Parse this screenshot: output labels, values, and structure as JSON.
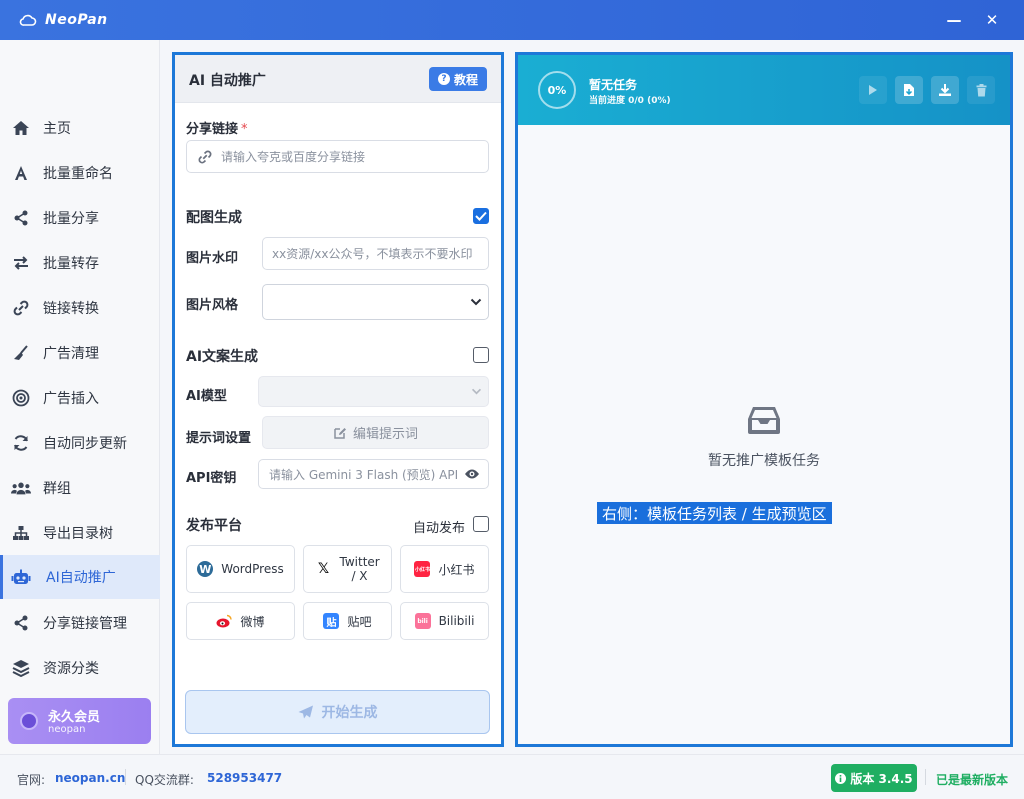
{
  "app": {
    "title": "NeoPan"
  },
  "window": {
    "minimize": "—",
    "close": "✕"
  },
  "sidebar": {
    "items": [
      {
        "label": "主页",
        "icon": "home-icon"
      },
      {
        "label": "批量重命名",
        "icon": "font-icon"
      },
      {
        "label": "批量分享",
        "icon": "share-icon"
      },
      {
        "label": "批量转存",
        "icon": "transfer-icon"
      },
      {
        "label": "链接转换",
        "icon": "link-icon"
      },
      {
        "label": "广告清理",
        "icon": "broom-icon"
      },
      {
        "label": "广告插入",
        "icon": "target-icon"
      },
      {
        "label": "自动同步更新",
        "icon": "sync-icon"
      },
      {
        "label": "群组",
        "icon": "group-icon"
      },
      {
        "label": "导出目录树",
        "icon": "tree-icon"
      },
      {
        "label": "AI自动推广",
        "icon": "robot-icon",
        "active": true
      },
      {
        "label": "分享链接管理",
        "icon": "share-icon"
      },
      {
        "label": "资源分类",
        "icon": "layers-icon"
      }
    ],
    "member": {
      "title": "永久会员",
      "subtitle": "neopan"
    }
  },
  "form": {
    "title": "AI 自动推广",
    "tutorial_label": "教程",
    "share_link": {
      "label": "分享链接",
      "required_mark": "*",
      "placeholder": "请输入夸克或百度分享链接"
    },
    "image_gen": {
      "label": "配图生成",
      "checked": true
    },
    "watermark": {
      "label": "图片水印",
      "placeholder": "xx资源/xx公众号，不填表示不要水印"
    },
    "style": {
      "label": "图片风格",
      "value": ""
    },
    "ai_copy": {
      "label": "AI文案生成",
      "checked": false
    },
    "ai_model": {
      "label": "AI模型",
      "value": ""
    },
    "prompt": {
      "label": "提示词设置",
      "button": "编辑提示词"
    },
    "api_key": {
      "label": "API密钥",
      "placeholder": "请输入 Gemini 3 Flash (预览) API"
    },
    "publish": {
      "label": "发布平台",
      "auto_label": "自动发布",
      "auto_checked": false,
      "platforms": [
        {
          "name": "WordPress",
          "icon": "wordpress-icon"
        },
        {
          "name": "Twitter / X",
          "icon": "x-icon"
        },
        {
          "name": "小红书",
          "icon": "xiaohongshu-icon",
          "icon_text": "小红书"
        },
        {
          "name": "微博",
          "icon": "weibo-icon"
        },
        {
          "name": "贴吧",
          "icon": "tieba-icon",
          "icon_text": "贴"
        },
        {
          "name": "Bilibili",
          "icon": "bilibili-icon",
          "icon_text": "bili"
        }
      ]
    },
    "start_label": "开始生成"
  },
  "task_panel": {
    "progress": "0%",
    "title": "暂无任务",
    "subtitle": "当前进度 0/0 (0%)",
    "empty_text": "暂无推广模板任务",
    "overlay_label": "右侧：模板任务列表 / 生成预览区"
  },
  "footer": {
    "site_label": "官网:",
    "site_value": "neopan.cn",
    "qq_label": "QQ交流群:",
    "qq_value": "528953477",
    "version": "版本 3.4.5",
    "latest": "已是最新版本"
  },
  "colors": {
    "accent": "#3a73df",
    "panel_border": "#1d78d8",
    "task_header": "#1aaed3",
    "success": "#1fae62",
    "member": "#a98ff3"
  }
}
